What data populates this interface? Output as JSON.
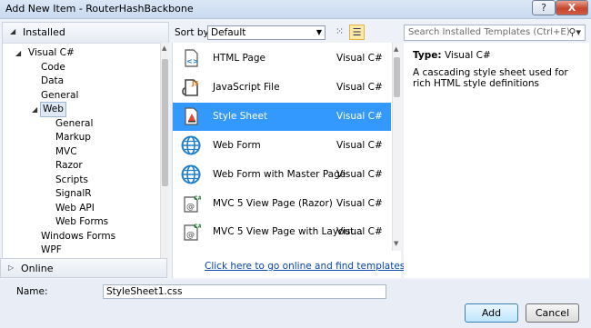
{
  "window": {
    "title": "Add New Item - RouterHashBackbone",
    "help_label": "?",
    "close_label": "X"
  },
  "left": {
    "installed_label": "Installed",
    "tree": [
      {
        "label": "Visual C#",
        "expanded": true,
        "level": 0
      },
      {
        "label": "Code",
        "level": 1
      },
      {
        "label": "Data",
        "level": 1
      },
      {
        "label": "General",
        "level": 1
      },
      {
        "label": "Web",
        "expanded": true,
        "level": 1,
        "selected": true
      },
      {
        "label": "General",
        "level": 2
      },
      {
        "label": "Markup",
        "level": 2
      },
      {
        "label": "MVC",
        "level": 2
      },
      {
        "label": "Razor",
        "level": 2
      },
      {
        "label": "Scripts",
        "level": 2
      },
      {
        "label": "SignalR",
        "level": 2
      },
      {
        "label": "Web API",
        "level": 2
      },
      {
        "label": "Web Forms",
        "level": 2
      },
      {
        "label": "Windows Forms",
        "level": 1
      },
      {
        "label": "WPF",
        "level": 1
      }
    ],
    "online_label": "Online"
  },
  "toolbar": {
    "sort_label": "Sort by:",
    "sort_value": "Default"
  },
  "search": {
    "placeholder": "Search Installed Templates (Ctrl+E)"
  },
  "templates": [
    {
      "name": "HTML Page",
      "lang": "Visual C#",
      "icon": "html-page-icon"
    },
    {
      "name": "JavaScript File",
      "lang": "Visual C#",
      "icon": "javascript-file-icon"
    },
    {
      "name": "Style Sheet",
      "lang": "Visual C#",
      "icon": "style-sheet-icon",
      "selected": true
    },
    {
      "name": "Web Form",
      "lang": "Visual C#",
      "icon": "globe-icon"
    },
    {
      "name": "Web Form with Master Page",
      "lang": "Visual C#",
      "icon": "globe-icon"
    },
    {
      "name": "MVC 5 View Page (Razor)",
      "lang": "Visual C#",
      "icon": "razor-page-icon"
    },
    {
      "name": "MVC 5 View Page with Layout...",
      "lang": "Visual C#",
      "icon": "razor-page-icon"
    }
  ],
  "online_link": "Click here to go online and find templates.",
  "details": {
    "type_label": "Type:",
    "type_value": "Visual C#",
    "description": "A cascading style sheet used for rich HTML style definitions"
  },
  "bottom": {
    "name_label": "Name:",
    "name_value": "StyleSheet1.css",
    "add_label": "Add",
    "cancel_label": "Cancel"
  }
}
